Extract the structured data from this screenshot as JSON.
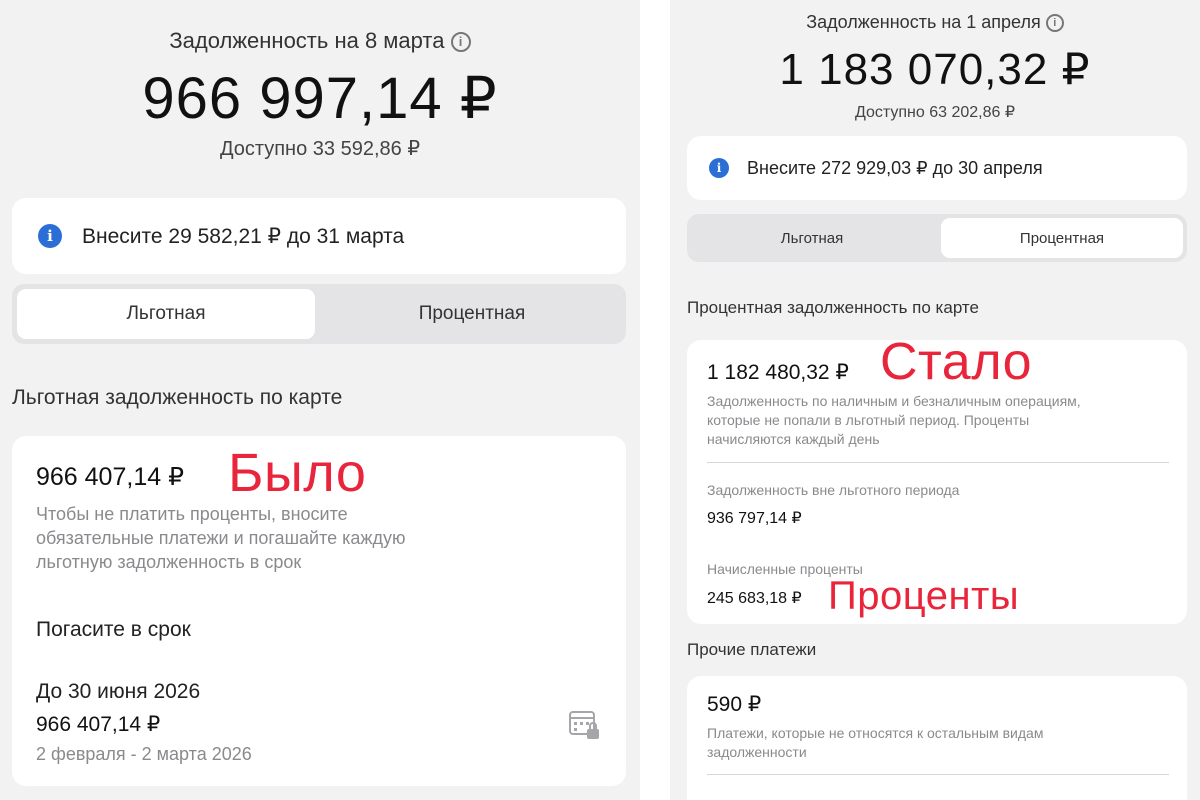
{
  "left": {
    "debt_title": "Задолженность на 8 марта",
    "debt_amount": "966 997,14 ₽",
    "available": "Доступно 33 592,86 ₽",
    "notice": "Внесите 29 582,21 ₽ до 31 марта",
    "tabs": [
      "Льготная",
      "Процентная"
    ],
    "active_tab": "Льготная",
    "section_title": "Льготная задолженность по карте",
    "card": {
      "amount": "966 407,14 ₽",
      "description_lines": [
        "Чтобы не платить проценты, вносите",
        "обязательные платежи и погашайте каждую",
        "льготную задолженность в срок"
      ],
      "repay_title": "Погасите в срок",
      "due": "До 30 июня 2026",
      "due_amount": "966 407,14 ₽",
      "period": "2 февраля - 2 марта 2026"
    },
    "overlay_label": "Было"
  },
  "right": {
    "debt_title": "Задолженность на 1 апреля",
    "debt_amount": "1 183 070,32 ₽",
    "available": "Доступно 63 202,86 ₽",
    "notice": "Внесите 272 929,03 ₽ до 30 апреля",
    "tabs": [
      "Льготная",
      "Процентная"
    ],
    "active_tab": "Процентная",
    "section_title": "Процентная задолженность по карте",
    "card": {
      "amount": "1 182 480,32 ₽",
      "description_lines": [
        "Задолженность по наличным и безналичным операциям,",
        "которые не попали в льготный период. Проценты",
        "начисляются каждый день"
      ],
      "out_of_grace_label": "Задолженность вне льготного периода",
      "out_of_grace_amount": "936 797,14 ₽",
      "interest_label": "Начисленные проценты",
      "interest_amount": "245 683,18 ₽"
    },
    "other_title": "Прочие платежи",
    "other_card": {
      "amount": "590 ₽",
      "description_lines": [
        "Платежи, которые не относятся к остальным видам",
        "задолженности"
      ]
    },
    "overlay_label_top": "Стало",
    "overlay_label_bottom": "Проценты"
  },
  "colors": {
    "accent_red": "#e8253b",
    "info_blue": "#2b6fd6"
  },
  "icons": {
    "info": "info-circle-icon",
    "notice": "info-filled-icon",
    "calendar": "calendar-lock-icon"
  }
}
